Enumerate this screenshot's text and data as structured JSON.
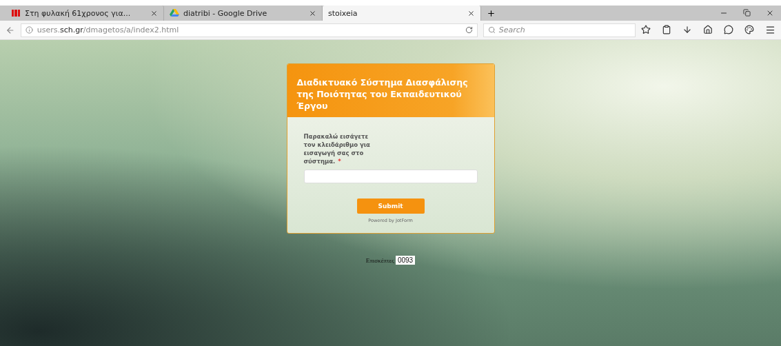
{
  "tabs": [
    {
      "label": "Στη φυλακή 61χρονος για...",
      "kind": "news",
      "selected": false
    },
    {
      "label": "diatribi - Google Drive",
      "kind": "drive",
      "selected": false
    },
    {
      "label": "stoixeia",
      "kind": "plain",
      "selected": true
    }
  ],
  "address_bar": {
    "host_prefix": "users.",
    "host_domain": "sch.gr",
    "path": "/dmagetos/a/index2.html"
  },
  "search": {
    "placeholder": "Search"
  },
  "form": {
    "title": "Διαδικτυακό Σύστημα Διασφάλισης της Ποιότητας του Εκπαιδευτικού Έργου",
    "label": "Παρακαλώ εισάγετε τον κλειδάριθμο για εισαγωγή σας στο σύστημα.",
    "required_mark": "*",
    "submit": "Submit",
    "powered_by": "Powered by JotForm"
  },
  "visitors": {
    "label": "Επισκέπτες",
    "count": "0093"
  }
}
